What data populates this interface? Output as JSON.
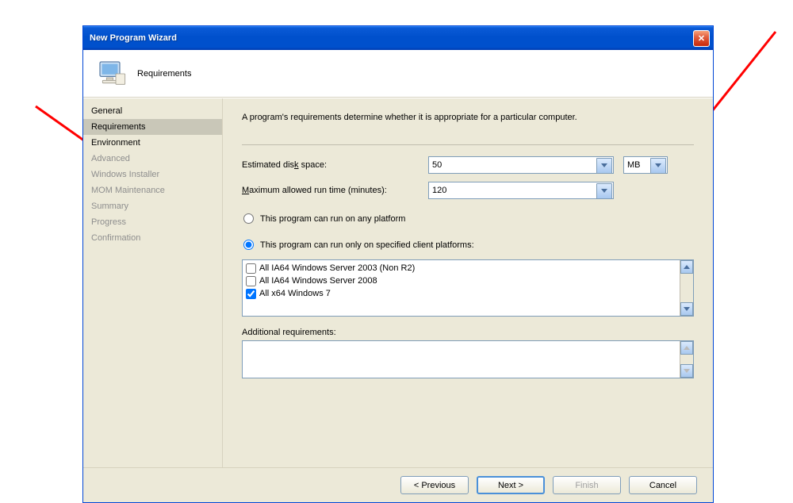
{
  "window": {
    "title": "New Program Wizard"
  },
  "header": {
    "title": "Requirements"
  },
  "sidebar": {
    "items": [
      {
        "label": "General",
        "mode": "normal"
      },
      {
        "label": "Requirements",
        "mode": "selected"
      },
      {
        "label": "Environment",
        "mode": "normal"
      },
      {
        "label": "Advanced",
        "mode": "dim"
      },
      {
        "label": "Windows Installer",
        "mode": "dim"
      },
      {
        "label": "MOM Maintenance",
        "mode": "dim"
      },
      {
        "label": "Summary",
        "mode": "dim"
      },
      {
        "label": "Progress",
        "mode": "dim"
      },
      {
        "label": "Confirmation",
        "mode": "dim"
      }
    ]
  },
  "content": {
    "intro": "A program's requirements determine whether it is appropriate for a particular computer.",
    "disk_label_pre": "Estimated dis",
    "disk_label_u": "k",
    "disk_label_post": " space:",
    "disk_value": "50",
    "disk_unit": "MB",
    "runtime_label_u": "M",
    "runtime_label_post": "aximum allowed run time (minutes):",
    "runtime_value": "120",
    "radio_any_pre": "This program ",
    "radio_any_u": "c",
    "radio_any_post": "an run on any platform",
    "radio_spec_pre": "This program can run ",
    "radio_spec_u": "o",
    "radio_spec_post": "nly on specified client platforms:",
    "radio_selected": "specified",
    "platforms": [
      {
        "label": "All IA64 Windows Server 2003 (Non R2)",
        "checked": false
      },
      {
        "label": "All IA64 Windows Server 2008",
        "checked": false
      },
      {
        "label": "All x64 Windows 7",
        "checked": true
      }
    ],
    "additional_label_pre": "Additional ",
    "additional_label_u": "r",
    "additional_label_post": "equirements:",
    "additional_value": ""
  },
  "footer": {
    "prev_u": "P",
    "prev_post": "revious",
    "next_pre": "N",
    "next_u": "e",
    "next_post": "xt >",
    "finish_u": "F",
    "finish_post": "inish",
    "cancel": "Cancel",
    "finish_enabled": false
  }
}
